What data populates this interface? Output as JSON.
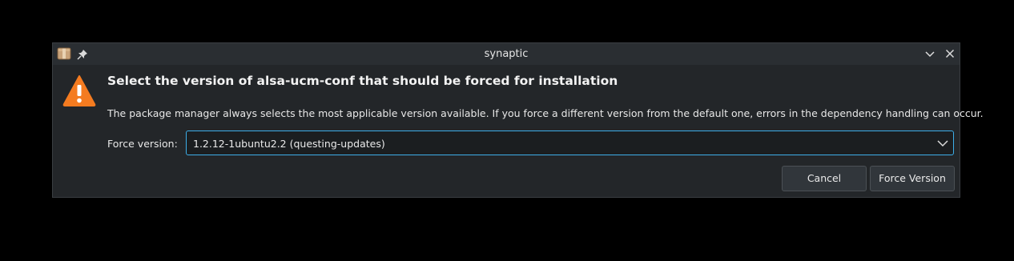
{
  "window": {
    "title": "synaptic",
    "app_icon": "package-icon",
    "pin_icon": "pin-icon",
    "minimize_icon": "chevron-down-icon",
    "close_icon": "close-icon"
  },
  "dialog": {
    "icon": "warning-icon",
    "heading": "Select the version of alsa-ucm-conf that should be forced for installation",
    "description": "The package manager always selects the most applicable version available. If you force a different version from the default one, errors in the dependency handling can occur.",
    "force_version_label": "Force version:",
    "force_version_value": "1.2.12-1ubuntu2.2 (questing-updates)",
    "cancel_label": "Cancel",
    "force_label": "Force Version"
  },
  "colors": {
    "accent": "#3daee9",
    "warning": "#f47b20",
    "window_bg": "#232629",
    "titlebar_bg": "#2a2e32"
  }
}
